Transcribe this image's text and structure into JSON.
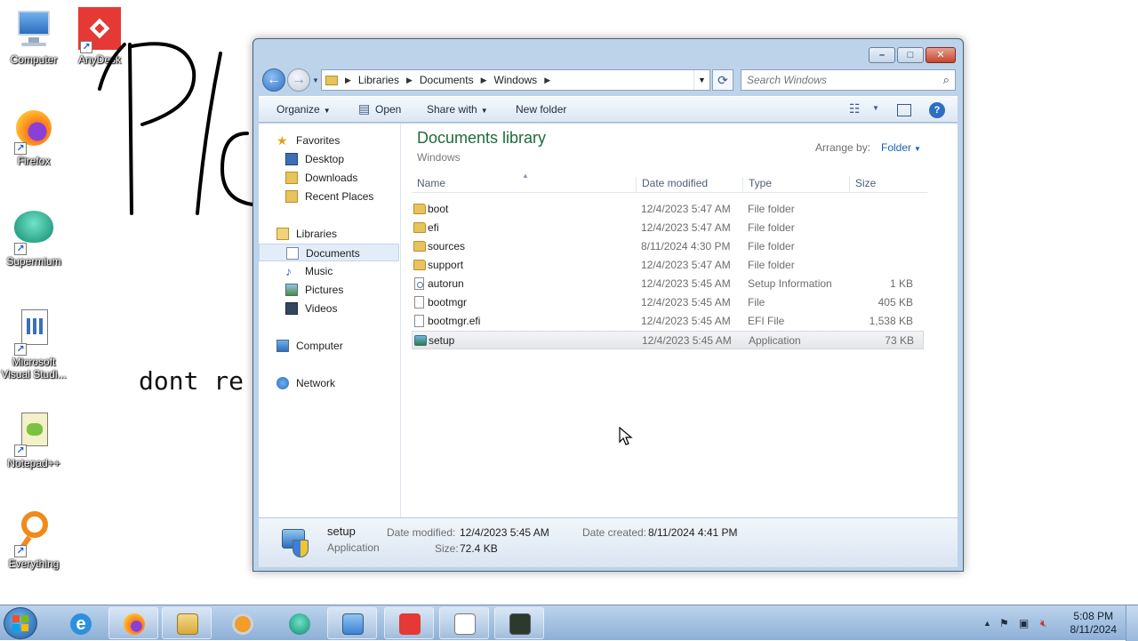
{
  "desktop": {
    "icons": [
      {
        "label": "Computer",
        "icon": "computer-icon"
      },
      {
        "label": "AnyDesk",
        "icon": "anydesk-icon"
      },
      {
        "label": "Firefox",
        "icon": "firefox-icon"
      },
      {
        "label": "Supermium",
        "icon": "supermium-icon"
      },
      {
        "label": "Microsoft Visual Studi...",
        "icon": "visual-studio-icon"
      },
      {
        "label": "Notepad++",
        "icon": "notepadpp-icon"
      },
      {
        "label": "Everything",
        "icon": "everything-icon"
      }
    ],
    "scribble_text": "Pl",
    "overlay_text": "dont re"
  },
  "window": {
    "caption_buttons": {
      "minimize": "–",
      "maximize": "□",
      "close": "✕"
    },
    "nav": {
      "back": "←",
      "forward": "→"
    },
    "breadcrumb": [
      "Libraries",
      "Documents",
      "Windows"
    ],
    "search_placeholder": "Search Windows",
    "toolbar": {
      "organize": "Organize",
      "open": "Open",
      "share_with": "Share with",
      "new_folder": "New folder"
    },
    "nav_pane": {
      "favorites": "Favorites",
      "desktop": "Desktop",
      "downloads": "Downloads",
      "recent_places": "Recent Places",
      "libraries": "Libraries",
      "documents": "Documents",
      "music": "Music",
      "pictures": "Pictures",
      "videos": "Videos",
      "computer": "Computer",
      "network": "Network"
    },
    "library_title": "Documents library",
    "library_subtitle": "Windows",
    "arrange_by_label": "Arrange by:",
    "arrange_by_value": "Folder",
    "columns": {
      "name": "Name",
      "date": "Date modified",
      "type": "Type",
      "size": "Size"
    },
    "files": [
      {
        "name": "boot",
        "date": "12/4/2023 5:47 AM",
        "type": "File folder",
        "size": "",
        "kind": "folder"
      },
      {
        "name": "efi",
        "date": "12/4/2023 5:47 AM",
        "type": "File folder",
        "size": "",
        "kind": "folder"
      },
      {
        "name": "sources",
        "date": "8/11/2024 4:30 PM",
        "type": "File folder",
        "size": "",
        "kind": "folder"
      },
      {
        "name": "support",
        "date": "12/4/2023 5:47 AM",
        "type": "File folder",
        "size": "",
        "kind": "folder"
      },
      {
        "name": "autorun",
        "date": "12/4/2023 5:45 AM",
        "type": "Setup Information",
        "size": "1 KB",
        "kind": "inf"
      },
      {
        "name": "bootmgr",
        "date": "12/4/2023 5:45 AM",
        "type": "File",
        "size": "405 KB",
        "kind": "doc"
      },
      {
        "name": "bootmgr.efi",
        "date": "12/4/2023 5:45 AM",
        "type": "EFI File",
        "size": "1,538 KB",
        "kind": "doc"
      },
      {
        "name": "setup",
        "date": "12/4/2023 5:45 AM",
        "type": "Application",
        "size": "73 KB",
        "kind": "app",
        "selected": true
      }
    ],
    "details": {
      "name": "setup",
      "kind": "Application",
      "date_modified_label": "Date modified:",
      "date_modified": "12/4/2023 5:45 AM",
      "date_created_label": "Date created:",
      "date_created": "8/11/2024 4:41 PM",
      "size_label": "Size:",
      "size": "72.4 KB"
    }
  },
  "taskbar": {
    "apps": [
      "internet-explorer-icon",
      "firefox-icon",
      "explorer-icon",
      "media-player-icon",
      "supermium-icon",
      "control-panel-icon",
      "anydesk-icon",
      "visual-studio-icon",
      "terminal-icon"
    ],
    "clock_time": "5:08 PM",
    "clock_date": "8/11/2024"
  },
  "colors": {
    "library_title": "#1e6b3a",
    "link_blue": "#1e5eb8",
    "anydesk_red": "#e53935"
  }
}
